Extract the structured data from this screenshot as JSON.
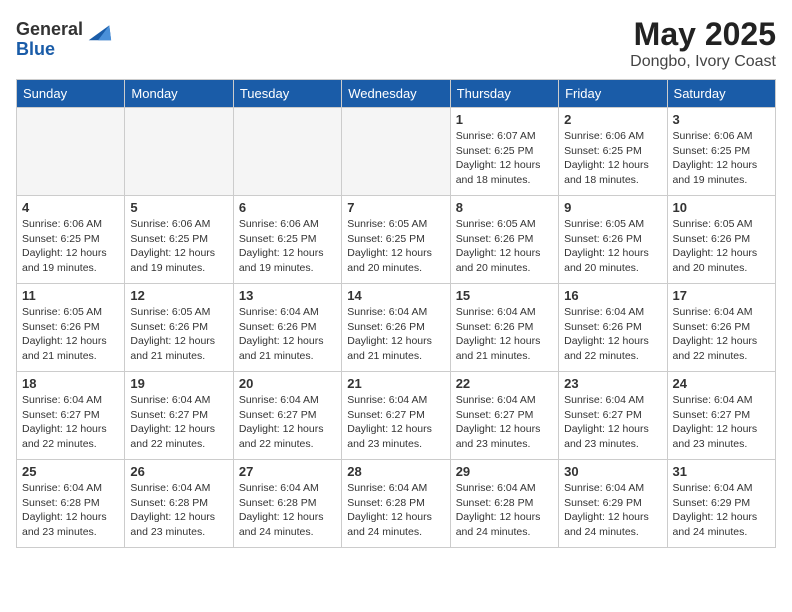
{
  "header": {
    "logo_general": "General",
    "logo_blue": "Blue",
    "month_year": "May 2025",
    "location": "Dongbo, Ivory Coast"
  },
  "weekdays": [
    "Sunday",
    "Monday",
    "Tuesday",
    "Wednesday",
    "Thursday",
    "Friday",
    "Saturday"
  ],
  "weeks": [
    [
      {
        "day": "",
        "info": ""
      },
      {
        "day": "",
        "info": ""
      },
      {
        "day": "",
        "info": ""
      },
      {
        "day": "",
        "info": ""
      },
      {
        "day": "1",
        "info": "Sunrise: 6:07 AM\nSunset: 6:25 PM\nDaylight: 12 hours\nand 18 minutes."
      },
      {
        "day": "2",
        "info": "Sunrise: 6:06 AM\nSunset: 6:25 PM\nDaylight: 12 hours\nand 18 minutes."
      },
      {
        "day": "3",
        "info": "Sunrise: 6:06 AM\nSunset: 6:25 PM\nDaylight: 12 hours\nand 19 minutes."
      }
    ],
    [
      {
        "day": "4",
        "info": "Sunrise: 6:06 AM\nSunset: 6:25 PM\nDaylight: 12 hours\nand 19 minutes."
      },
      {
        "day": "5",
        "info": "Sunrise: 6:06 AM\nSunset: 6:25 PM\nDaylight: 12 hours\nand 19 minutes."
      },
      {
        "day": "6",
        "info": "Sunrise: 6:06 AM\nSunset: 6:25 PM\nDaylight: 12 hours\nand 19 minutes."
      },
      {
        "day": "7",
        "info": "Sunrise: 6:05 AM\nSunset: 6:25 PM\nDaylight: 12 hours\nand 20 minutes."
      },
      {
        "day": "8",
        "info": "Sunrise: 6:05 AM\nSunset: 6:26 PM\nDaylight: 12 hours\nand 20 minutes."
      },
      {
        "day": "9",
        "info": "Sunrise: 6:05 AM\nSunset: 6:26 PM\nDaylight: 12 hours\nand 20 minutes."
      },
      {
        "day": "10",
        "info": "Sunrise: 6:05 AM\nSunset: 6:26 PM\nDaylight: 12 hours\nand 20 minutes."
      }
    ],
    [
      {
        "day": "11",
        "info": "Sunrise: 6:05 AM\nSunset: 6:26 PM\nDaylight: 12 hours\nand 21 minutes."
      },
      {
        "day": "12",
        "info": "Sunrise: 6:05 AM\nSunset: 6:26 PM\nDaylight: 12 hours\nand 21 minutes."
      },
      {
        "day": "13",
        "info": "Sunrise: 6:04 AM\nSunset: 6:26 PM\nDaylight: 12 hours\nand 21 minutes."
      },
      {
        "day": "14",
        "info": "Sunrise: 6:04 AM\nSunset: 6:26 PM\nDaylight: 12 hours\nand 21 minutes."
      },
      {
        "day": "15",
        "info": "Sunrise: 6:04 AM\nSunset: 6:26 PM\nDaylight: 12 hours\nand 21 minutes."
      },
      {
        "day": "16",
        "info": "Sunrise: 6:04 AM\nSunset: 6:26 PM\nDaylight: 12 hours\nand 22 minutes."
      },
      {
        "day": "17",
        "info": "Sunrise: 6:04 AM\nSunset: 6:26 PM\nDaylight: 12 hours\nand 22 minutes."
      }
    ],
    [
      {
        "day": "18",
        "info": "Sunrise: 6:04 AM\nSunset: 6:27 PM\nDaylight: 12 hours\nand 22 minutes."
      },
      {
        "day": "19",
        "info": "Sunrise: 6:04 AM\nSunset: 6:27 PM\nDaylight: 12 hours\nand 22 minutes."
      },
      {
        "day": "20",
        "info": "Sunrise: 6:04 AM\nSunset: 6:27 PM\nDaylight: 12 hours\nand 22 minutes."
      },
      {
        "day": "21",
        "info": "Sunrise: 6:04 AM\nSunset: 6:27 PM\nDaylight: 12 hours\nand 23 minutes."
      },
      {
        "day": "22",
        "info": "Sunrise: 6:04 AM\nSunset: 6:27 PM\nDaylight: 12 hours\nand 23 minutes."
      },
      {
        "day": "23",
        "info": "Sunrise: 6:04 AM\nSunset: 6:27 PM\nDaylight: 12 hours\nand 23 minutes."
      },
      {
        "day": "24",
        "info": "Sunrise: 6:04 AM\nSunset: 6:27 PM\nDaylight: 12 hours\nand 23 minutes."
      }
    ],
    [
      {
        "day": "25",
        "info": "Sunrise: 6:04 AM\nSunset: 6:28 PM\nDaylight: 12 hours\nand 23 minutes."
      },
      {
        "day": "26",
        "info": "Sunrise: 6:04 AM\nSunset: 6:28 PM\nDaylight: 12 hours\nand 23 minutes."
      },
      {
        "day": "27",
        "info": "Sunrise: 6:04 AM\nSunset: 6:28 PM\nDaylight: 12 hours\nand 24 minutes."
      },
      {
        "day": "28",
        "info": "Sunrise: 6:04 AM\nSunset: 6:28 PM\nDaylight: 12 hours\nand 24 minutes."
      },
      {
        "day": "29",
        "info": "Sunrise: 6:04 AM\nSunset: 6:28 PM\nDaylight: 12 hours\nand 24 minutes."
      },
      {
        "day": "30",
        "info": "Sunrise: 6:04 AM\nSunset: 6:29 PM\nDaylight: 12 hours\nand 24 minutes."
      },
      {
        "day": "31",
        "info": "Sunrise: 6:04 AM\nSunset: 6:29 PM\nDaylight: 12 hours\nand 24 minutes."
      }
    ]
  ]
}
